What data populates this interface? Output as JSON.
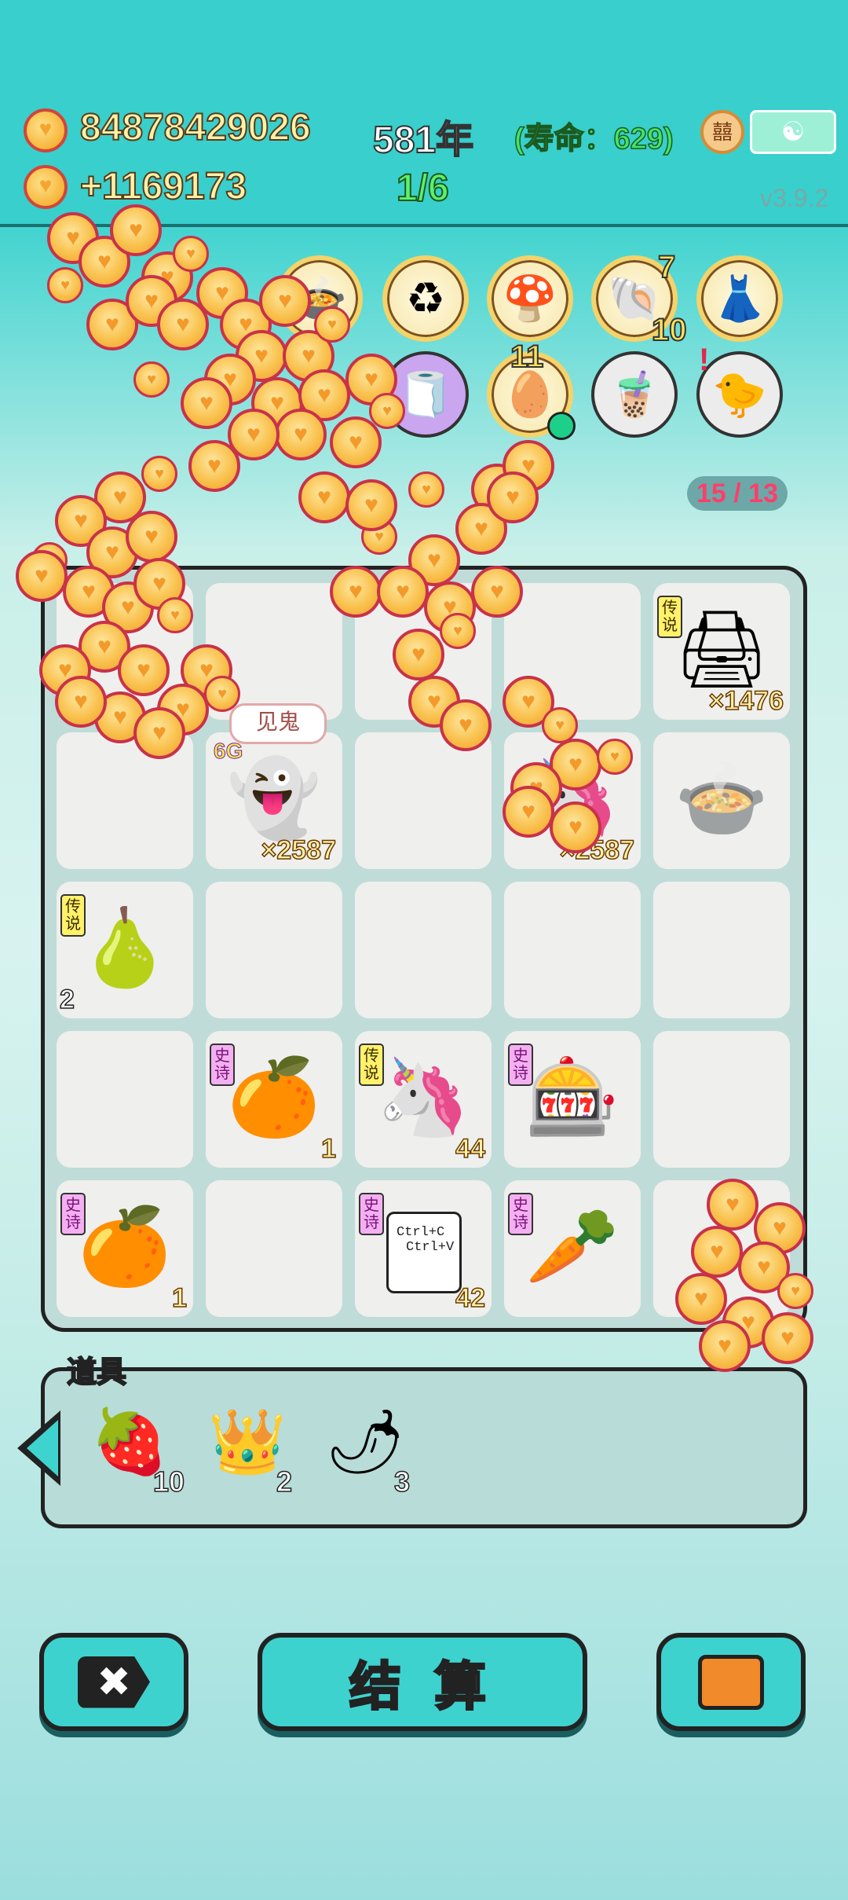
{
  "header": {
    "money": "84878429026",
    "income": "+1169173",
    "year": "581年",
    "lifespan": "(寿命：629)",
    "progress": "1/6",
    "version": "v3.9.2",
    "badge_icon": "囍",
    "meditate_icon": "meditation-icon"
  },
  "top_items": [
    {
      "name": "pressure-cooker-icon",
      "glyph": "🍲"
    },
    {
      "name": "recycle-icon",
      "glyph": "♻"
    },
    {
      "name": "mushroom-cloud-icon",
      "glyph": "🍄"
    },
    {
      "name": "shell-icon",
      "glyph": "🐚",
      "top_count": "7",
      "bottom_count": "10"
    },
    {
      "name": "skirt-icon",
      "glyph": "👗"
    },
    {
      "name": "tissue-box-icon",
      "glyph": "🧻"
    },
    {
      "name": "egg-tray-icon",
      "glyph": "🥚",
      "count": "11"
    },
    {
      "name": "bubble-tea-icon",
      "glyph": "🧋"
    },
    {
      "name": "chick-icon",
      "glyph": "🐤",
      "alert": "!"
    }
  ],
  "counter": "15 / 13",
  "board": {
    "speech": "见鬼",
    "cells": [
      {
        "name": "printer-cell",
        "tag": "传说",
        "tag_type": "leg",
        "glyph": "🖨",
        "count": "×1476"
      },
      {
        "name": "ghost-king-cell",
        "glyph": "👻",
        "count": "×2587",
        "label": "6G"
      },
      {
        "name": "pink-unicorn-cell",
        "glyph": "🦄",
        "count": "×2587"
      },
      {
        "name": "cooker-cell",
        "glyph": "🍲"
      },
      {
        "name": "pear-cell",
        "tag": "传说",
        "tag_type": "leg",
        "glyph": "🍐",
        "count": "2"
      },
      {
        "name": "orange-cell-1",
        "tag": "史诗",
        "tag_type": "epic",
        "glyph": "🍊",
        "count": "1"
      },
      {
        "name": "unicorn-cell",
        "tag": "传说",
        "tag_type": "leg",
        "glyph": "🦄",
        "count": "44"
      },
      {
        "name": "gashapon-cell",
        "tag": "史诗",
        "tag_type": "epic",
        "glyph": "🎰"
      },
      {
        "name": "orange-cell-2",
        "tag": "史诗",
        "tag_type": "epic",
        "glyph": "🍊",
        "count": "1"
      },
      {
        "name": "copy-paste-cell",
        "tag": "史诗",
        "tag_type": "epic",
        "line1": "Ctrl+C",
        "line2": "Ctrl+V",
        "count": "42"
      },
      {
        "name": "carrot-cell",
        "tag": "史诗",
        "tag_type": "epic",
        "glyph": "🥕"
      }
    ]
  },
  "tools": {
    "title": "道具",
    "items": [
      {
        "name": "strawberry-tool",
        "glyph": "🍓",
        "count": "10"
      },
      {
        "name": "crown-tool",
        "glyph": "👑",
        "count": "2"
      },
      {
        "name": "chili-tool",
        "glyph": "🌶",
        "count": "3"
      }
    ]
  },
  "buttons": {
    "exit_icon": "✖",
    "settle": "结 算",
    "bag_icon": "briefcase-icon"
  },
  "colors": {
    "accent": "#3ed2cf",
    "coin": "#f9c14d",
    "coin_border": "#c8324a"
  }
}
